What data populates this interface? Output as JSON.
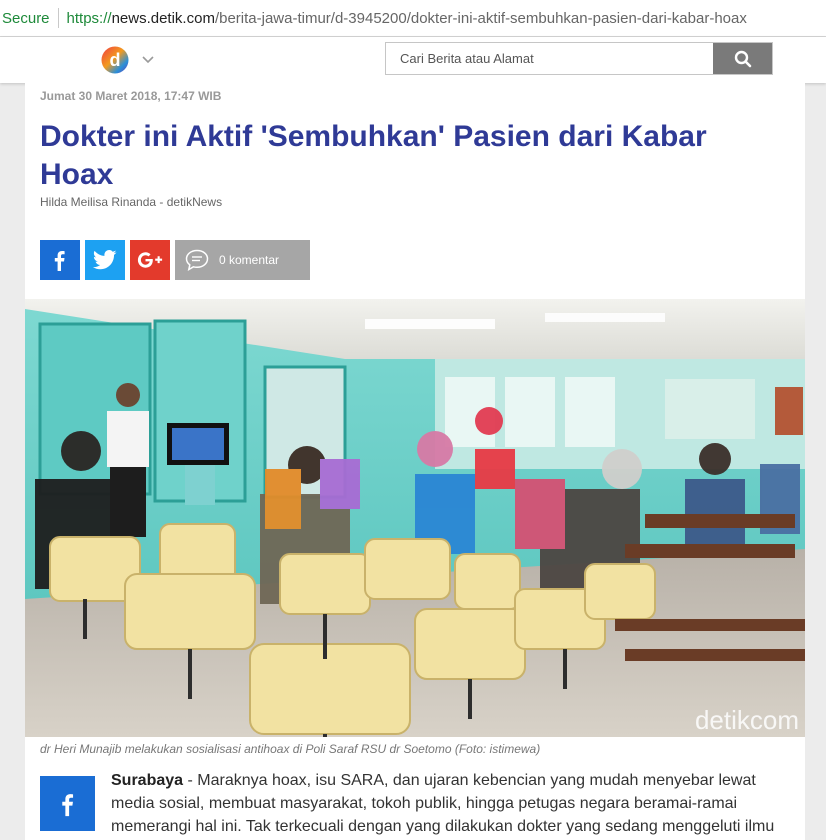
{
  "browser": {
    "secure_label": "Secure",
    "url_scheme": "https://",
    "url_host": "news.detik.com",
    "url_path": "/berita-jawa-timur/d-3945200/dokter-ini-aktif-sembuhkan-pasien-dari-kabar-hoax"
  },
  "header": {
    "logo_letter": "d",
    "search_placeholder": "Cari Berita atau Alamat"
  },
  "article": {
    "date": "Jumat 30 Maret 2018, 17:47 WIB",
    "title": "Dokter ini Aktif 'Sembuhkan' Pasien dari Kabar Hoax",
    "author": "Hilda Meilisa Rinanda - detikNews",
    "comments_label": "0 komentar",
    "photo_watermark": "detikcom",
    "caption": "dr Heri Munajib melakukan sosialisasi antihoax di Poli Saraf RSU dr Soetomo (Foto: istimewa)",
    "city": "Surabaya",
    "body": " - Maraknya hoax, isu SARA, dan ujaran kebencian yang mudah menyebar lewat media sosial, membuat masyarakat, tokoh publik, hingga petugas negara beramai-ramai memerangi hal ini. Tak terkecuali dengan yang dilakukan dokter yang sedang menggeluti ilmu"
  },
  "colors": {
    "title": "#2f3a96",
    "facebook": "#1a6dd4",
    "twitter": "#1da1f2",
    "googleplus": "#e33a2c",
    "secure": "#1e8a3a"
  },
  "icons": {
    "search": "search-icon",
    "facebook": "facebook-icon",
    "twitter": "twitter-icon",
    "googleplus": "google-plus-icon",
    "comment": "comment-icon",
    "chevron": "chevron-down-icon"
  }
}
